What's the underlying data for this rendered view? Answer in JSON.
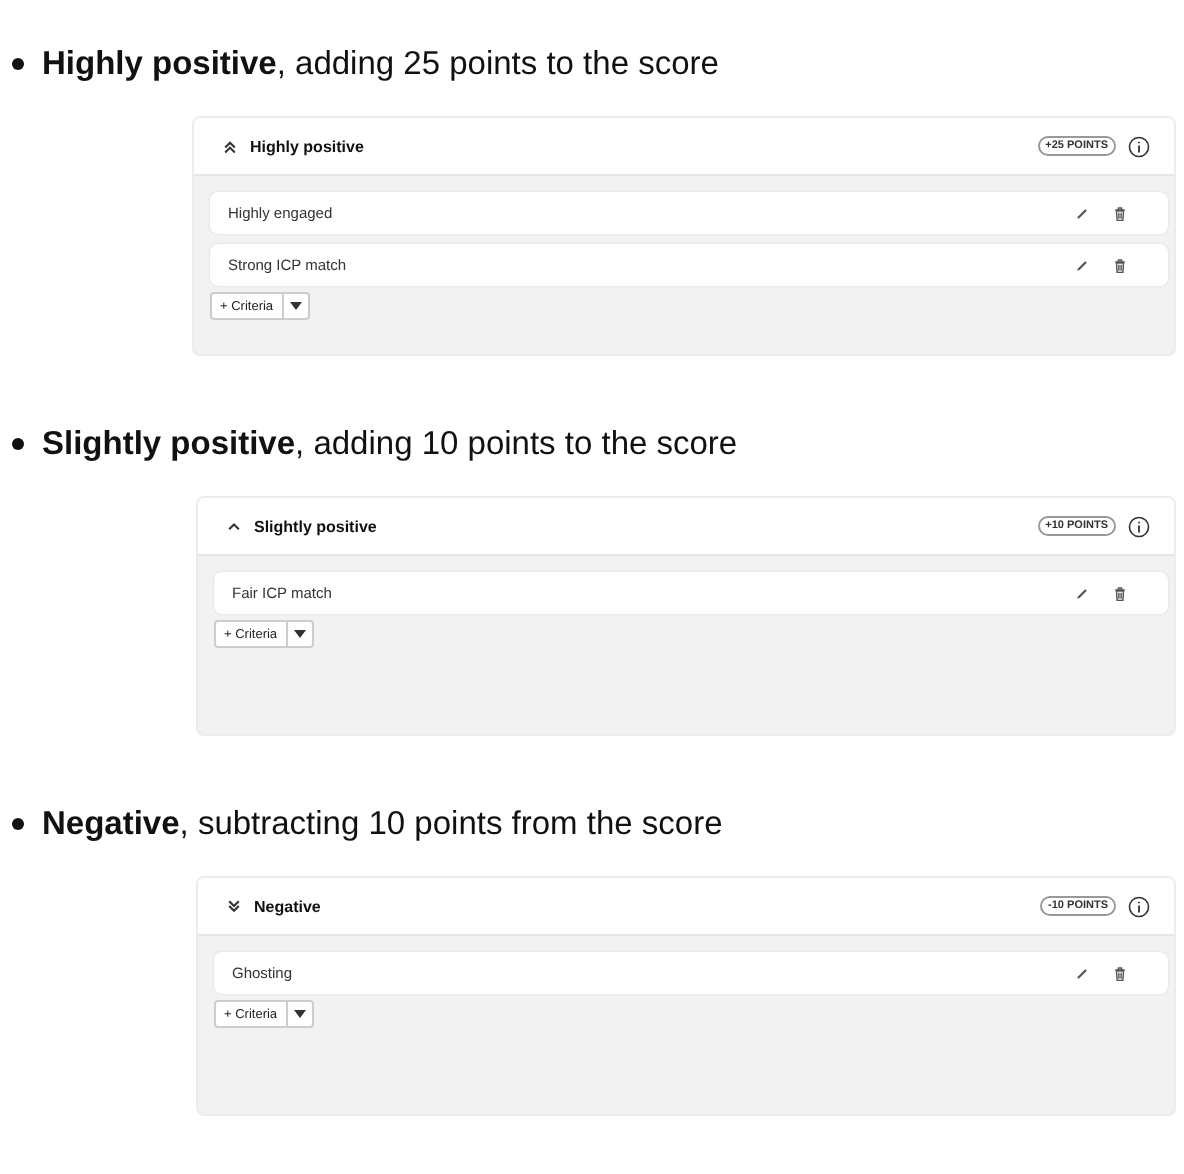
{
  "sections": [
    {
      "heading": "**Highly positive**, adding 25 points to the score",
      "card": {
        "kind": "double-up",
        "title": "Highly positive",
        "points": "+25 POINTS",
        "criteria": [
          "Highly engaged",
          "Strong ICP match"
        ],
        "add_button": "+ Criteria"
      }
    },
    {
      "heading": "**Slightly positive**, adding 10 points to the score",
      "card": {
        "kind": "up",
        "title": "Slightly positive",
        "points": "+10 POINTS",
        "criteria": [
          "Fair ICP match"
        ],
        "add_button": "+ Criteria"
      }
    },
    {
      "heading": "**Negative**, subtracting 10 points from the score",
      "card": {
        "kind": "double-down",
        "title": "Negative",
        "points": "-10 POINTS",
        "criteria": [
          "Ghosting"
        ],
        "add_button": "+ Criteria"
      }
    }
  ]
}
